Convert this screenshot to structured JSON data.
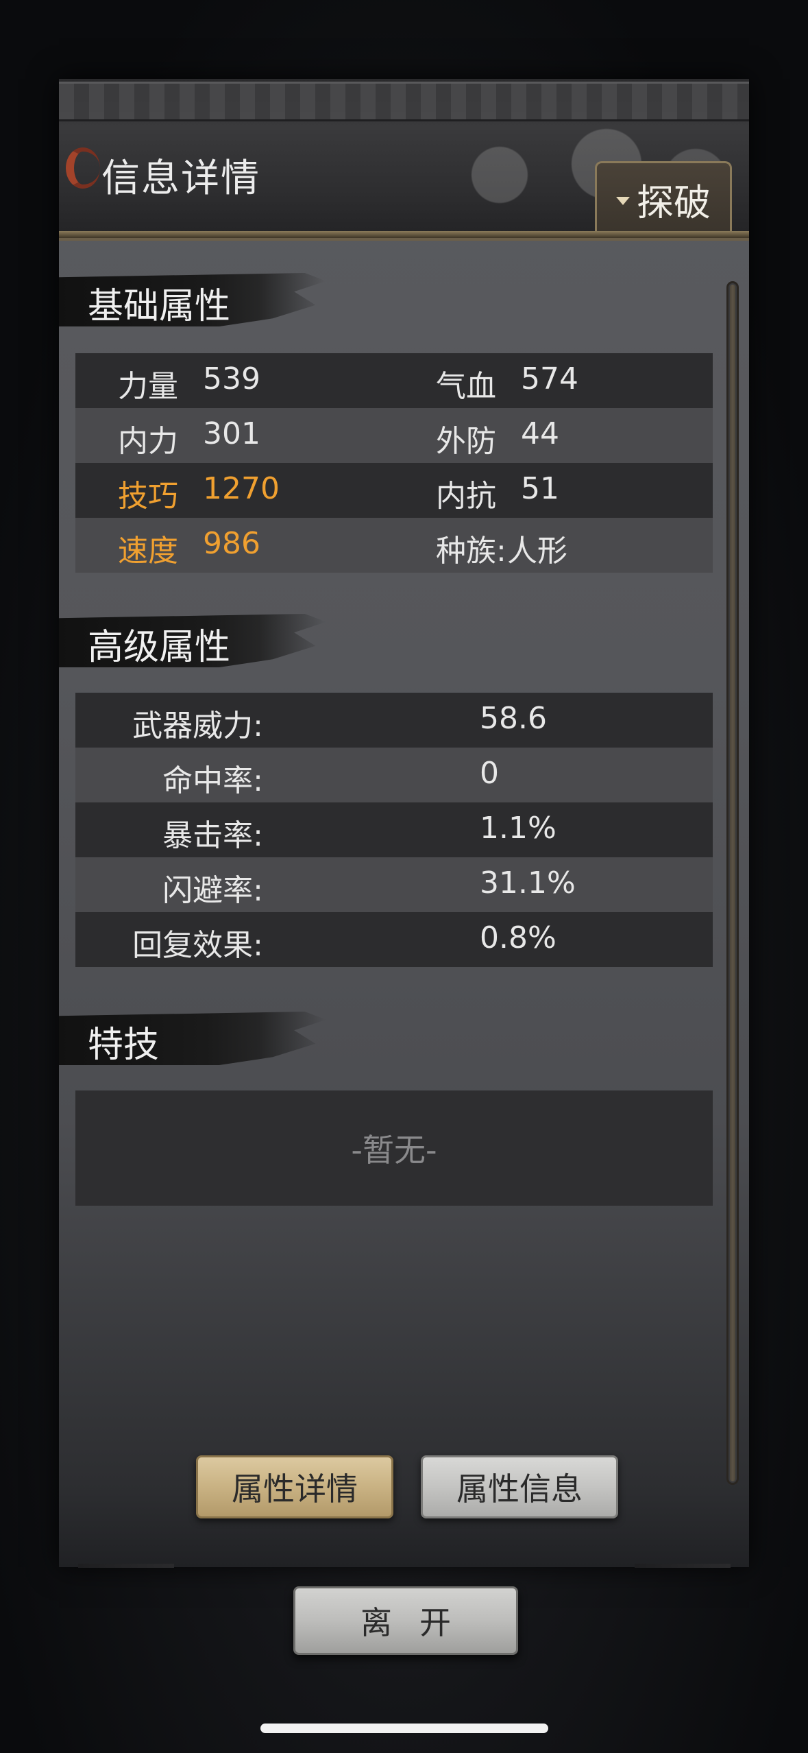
{
  "header": {
    "title": "信息详情",
    "tanpo_label": "探破"
  },
  "basic": {
    "title": "基础属性",
    "rows": [
      {
        "l_label": "力量",
        "l_value": "539",
        "r_label": "气血",
        "r_value": "574",
        "highlight": false
      },
      {
        "l_label": "内力",
        "l_value": "301",
        "r_label": "外防",
        "r_value": "44",
        "highlight": false
      },
      {
        "l_label": "技巧",
        "l_value": "1270",
        "r_label": "内抗",
        "r_value": "51",
        "highlight": true
      },
      {
        "l_label": "速度",
        "l_value": "986",
        "r_label": "种族:",
        "r_value": "人形",
        "highlight": true
      }
    ]
  },
  "advanced": {
    "title": "高级属性",
    "rows": [
      {
        "label": "武器威力:",
        "value": "58.6"
      },
      {
        "label": "命中率:",
        "value": "0"
      },
      {
        "label": "暴击率:",
        "value": "1.1%"
      },
      {
        "label": "闪避率:",
        "value": "31.1%"
      },
      {
        "label": "回复效果:",
        "value": "0.8%"
      }
    ]
  },
  "skills": {
    "title": "特技",
    "empty_text": "-暂无-"
  },
  "tabs": {
    "active_label": "属性详情",
    "inactive_label": "属性信息"
  },
  "leave_label": "离开",
  "colors": {
    "highlight": "#f0a030",
    "active_tab": "#c9b283"
  }
}
